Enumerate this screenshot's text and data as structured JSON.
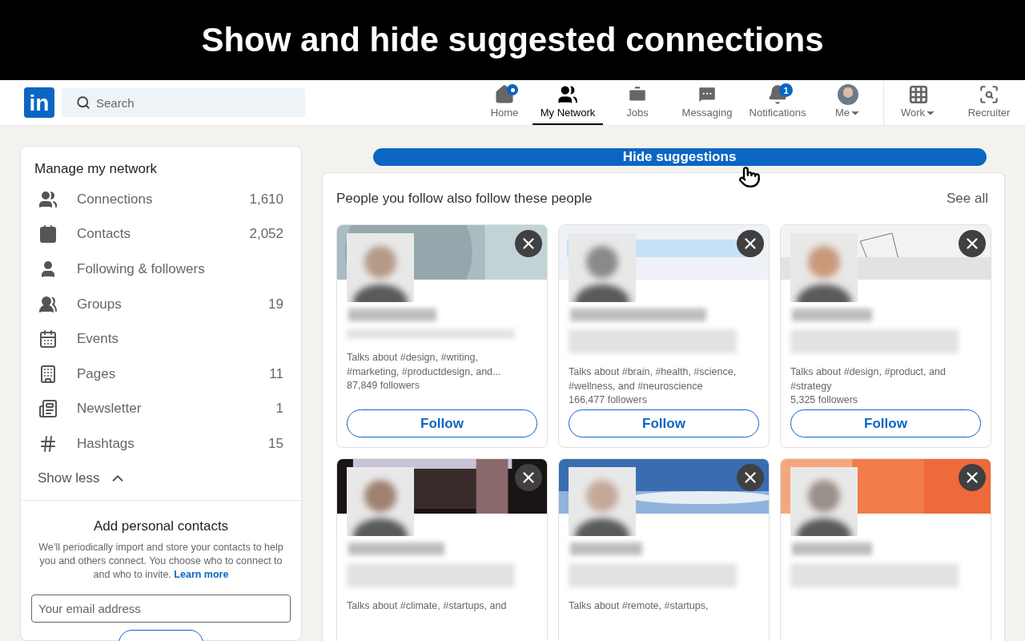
{
  "banner": {
    "title": "Show and hide suggested connections"
  },
  "nav": {
    "logo": "in",
    "search": {
      "placeholder": "Search"
    },
    "items": [
      {
        "kind": "home",
        "label": "Home",
        "selected": false,
        "dot": true
      },
      {
        "kind": "network",
        "label": "My Network",
        "selected": true
      },
      {
        "kind": "jobs",
        "label": "Jobs",
        "selected": false
      },
      {
        "kind": "messaging",
        "label": "Messaging",
        "selected": false
      },
      {
        "kind": "bell",
        "label": "Notifications",
        "selected": false,
        "badge": "1"
      },
      {
        "kind": "me",
        "label": "Me",
        "selected": false,
        "caret": true
      }
    ],
    "extras": [
      {
        "kind": "grid",
        "label": "Work",
        "caret": true
      },
      {
        "kind": "recruiter",
        "label": "Recruiter"
      }
    ]
  },
  "sidebar": {
    "title": "Manage my network",
    "items": [
      {
        "label": "Connections",
        "count": "1,610"
      },
      {
        "label": "Contacts",
        "count": "2,052"
      },
      {
        "label": "Following & followers"
      },
      {
        "label": "Groups",
        "count": "19"
      },
      {
        "label": "Events"
      },
      {
        "label": "Pages",
        "count": "11"
      },
      {
        "label": "Newsletter",
        "count": "1"
      },
      {
        "label": "Hashtags",
        "count": "15"
      }
    ],
    "toggle": {
      "label": "Show less",
      "expanded": true
    },
    "contacts": {
      "title": "Add personal contacts",
      "text": "We’ll periodically import and store your contacts to help you and others connect. You choose who to connect to and who to invite.",
      "link": "Learn more",
      "email": {
        "placeholder": "Your email address"
      }
    }
  },
  "hide_button": {
    "label": "Hide suggestions"
  },
  "suggestions": {
    "title": "People you follow also follow these people",
    "see_all": "See all",
    "cards": [
      {
        "kind": "profile",
        "talks": "Talks about #design, #writing, #marketing, #productdesign, and...",
        "followers": "87,849 followers",
        "follow": "Follow"
      },
      {
        "kind": "profile",
        "talks": "Talks about #brain, #health, #science, #wellness, and #neuroscience",
        "followers": "166,477 followers",
        "follow": "Follow"
      },
      {
        "kind": "profile",
        "talks": "Talks about #design, #product, and #strategy",
        "followers": "5,325 followers",
        "follow": "Follow"
      },
      {
        "kind": "profile",
        "talks": "Talks about #climate, #startups, and"
      },
      {
        "kind": "profile",
        "talks": "Talks about #remote, #startups,"
      },
      {
        "kind": "profile"
      }
    ]
  }
}
